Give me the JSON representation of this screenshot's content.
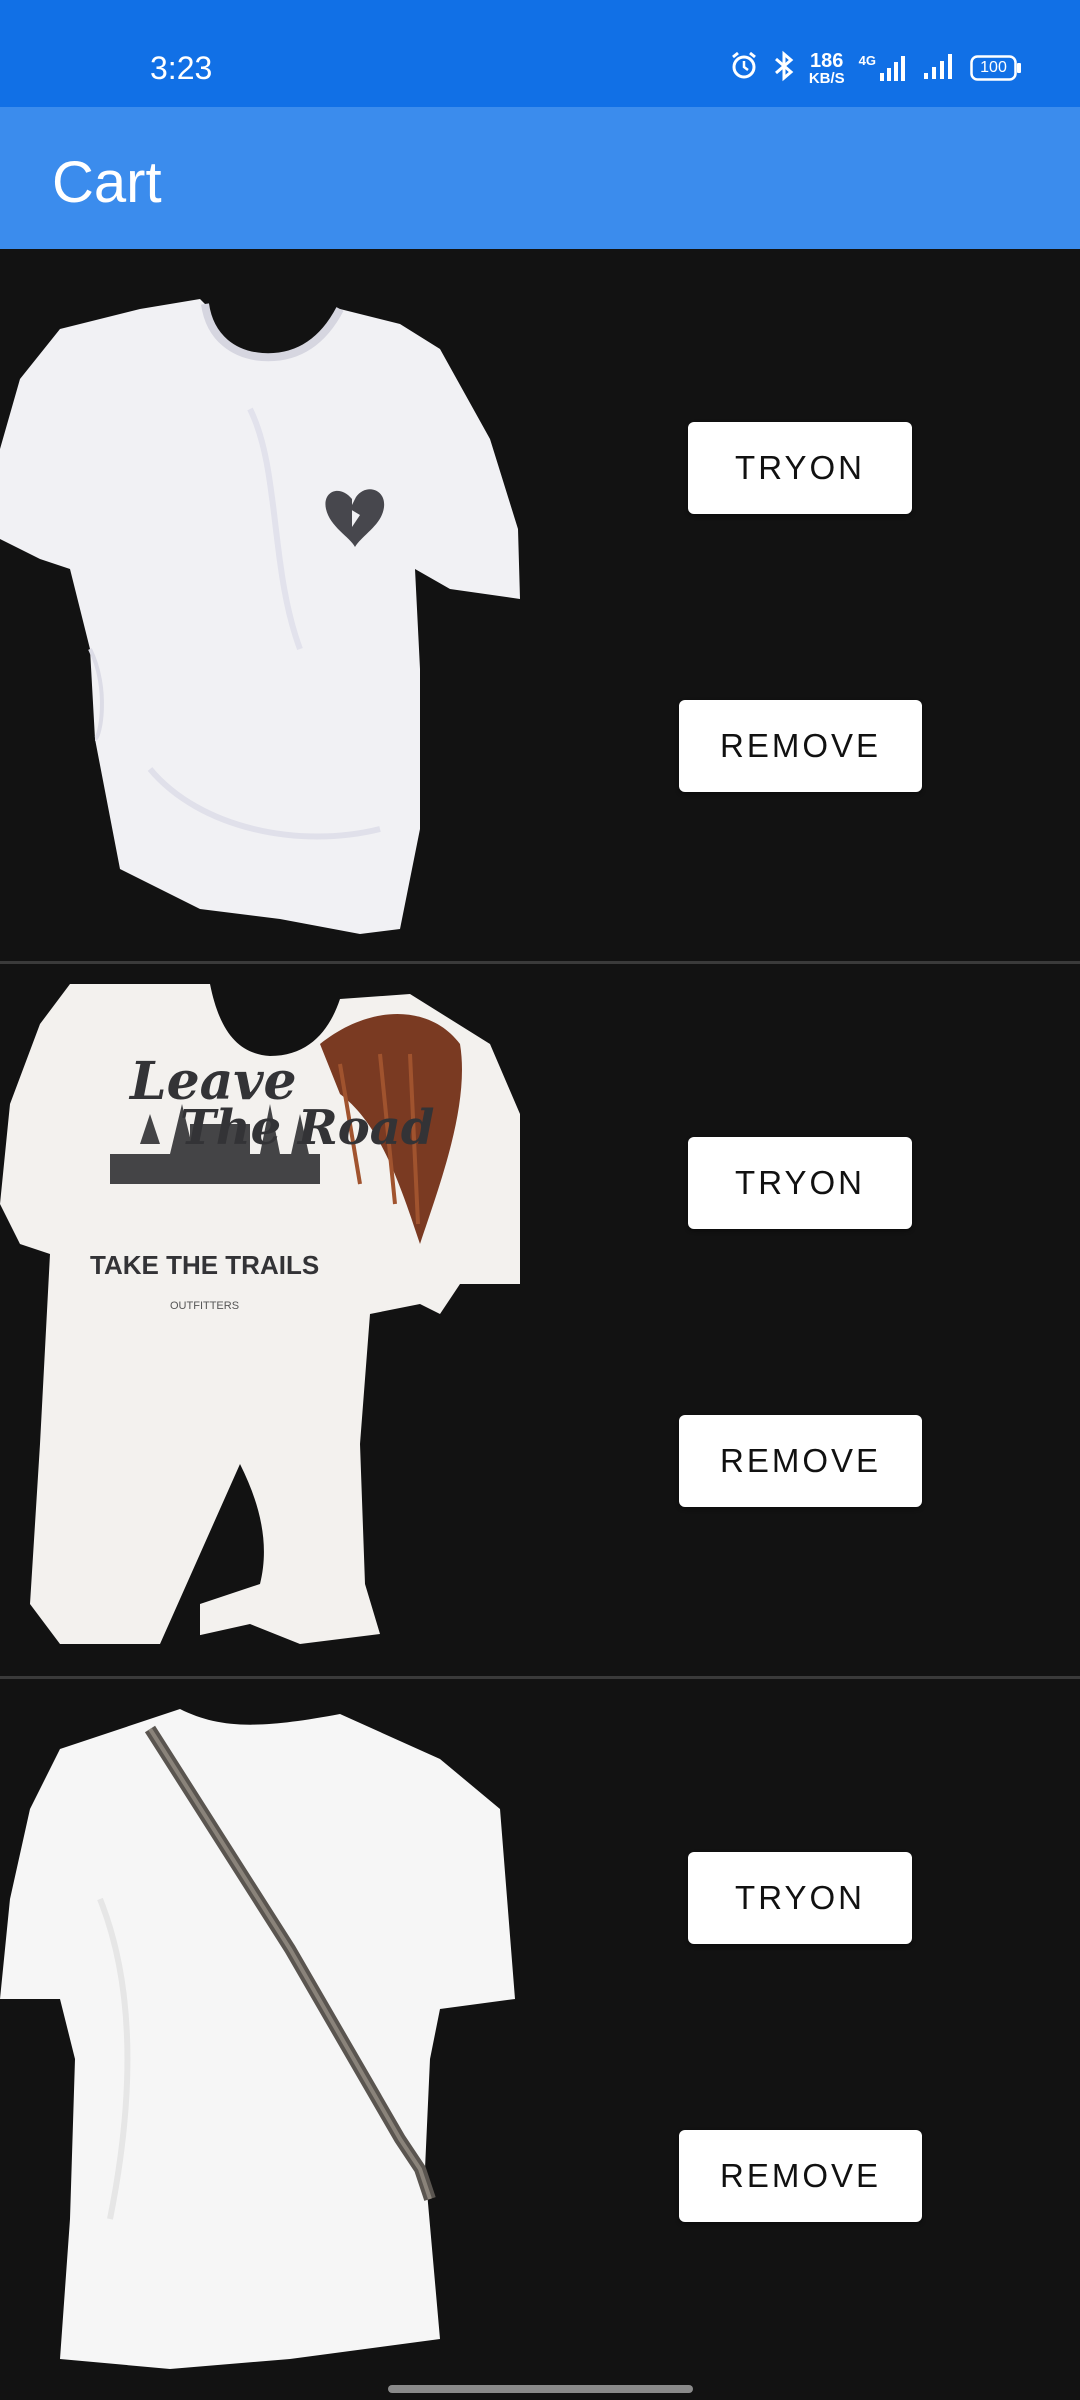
{
  "status_bar": {
    "time": "3:23",
    "net_speed_value": "186",
    "net_speed_unit": "KB/S",
    "network_type": "4G",
    "battery": "100",
    "icons": [
      "alarm-icon",
      "bluetooth-icon",
      "signal-4g-icon",
      "signal-icon",
      "battery-icon"
    ]
  },
  "app_bar": {
    "title": "Cart"
  },
  "cart": {
    "items": [
      {
        "image_icon": "tshirt-broken-heart-image",
        "tryon_label": "TRYON",
        "remove_label": "REMOVE"
      },
      {
        "image_icon": "tshirt-leave-the-road-image",
        "print_line1": "Leave",
        "print_line2": "The Road",
        "print_line3": "TAKE THE TRAILS",
        "print_line4": "OUTFITTERS",
        "tryon_label": "TRYON",
        "remove_label": "REMOVE"
      },
      {
        "image_icon": "tshirt-back-with-strap-image",
        "tryon_label": "TRYON",
        "remove_label": "REMOVE"
      }
    ]
  },
  "colors": {
    "status_bar": "#1170e6",
    "app_bar": "#3b8ced",
    "background": "#121212",
    "button_bg": "#ffffff",
    "divider": "#3a3a3a"
  }
}
